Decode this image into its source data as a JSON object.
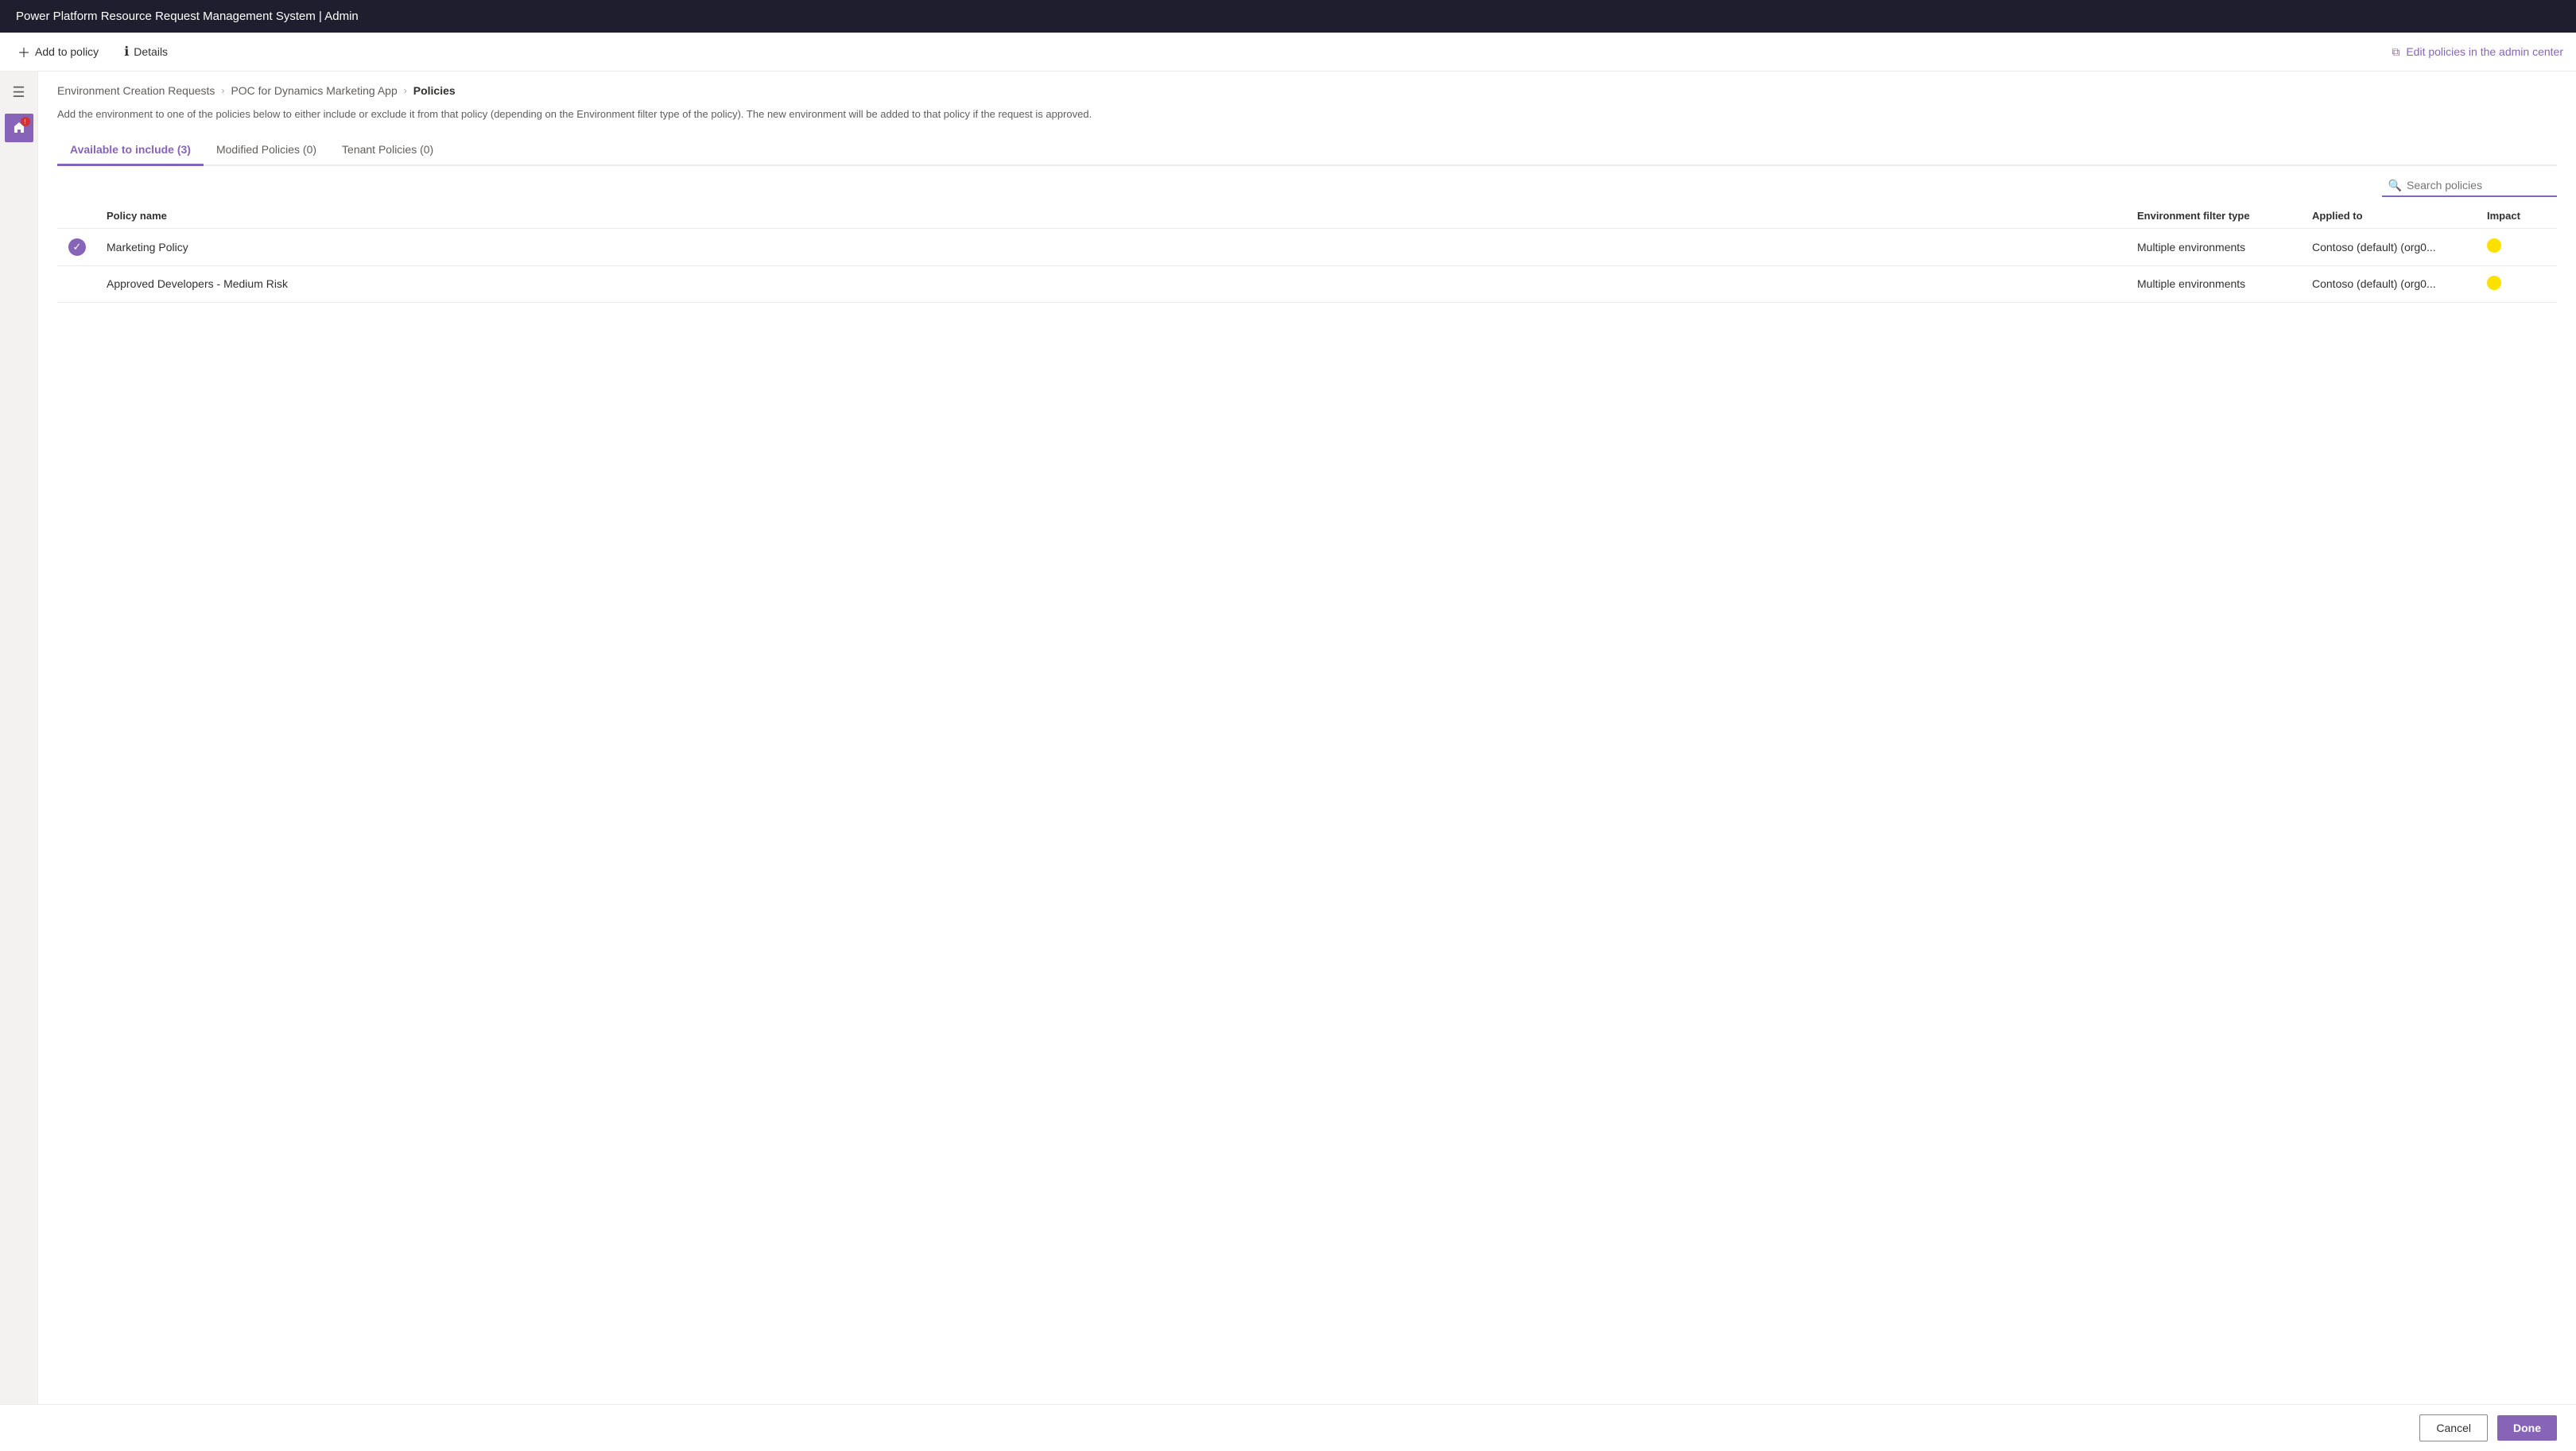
{
  "titleBar": {
    "text": "Power Platform Resource Request Management System | Admin"
  },
  "toolbar": {
    "addToPolicyLabel": "Add to policy",
    "detailsLabel": "Details",
    "editPoliciesLabel": "Edit policies in the admin center"
  },
  "breadcrumb": {
    "item1": "Environment Creation Requests",
    "item2": "POC for Dynamics Marketing App",
    "item3": "Policies"
  },
  "description": "Add the environment to one of the policies below to either include or exclude it from that policy (depending on the Environment filter type of the policy). The new environment will be added to that policy if the request is approved.",
  "tabs": [
    {
      "label": "Available to include (3)",
      "active": true
    },
    {
      "label": "Modified Policies (0)",
      "active": false
    },
    {
      "label": "Tenant Policies (0)",
      "active": false
    }
  ],
  "search": {
    "placeholder": "Search policies"
  },
  "table": {
    "columns": [
      {
        "key": "check",
        "label": ""
      },
      {
        "key": "policyName",
        "label": "Policy name"
      },
      {
        "key": "envFilterType",
        "label": "Environment filter type"
      },
      {
        "key": "appliedTo",
        "label": "Applied to"
      },
      {
        "key": "impact",
        "label": "Impact"
      }
    ],
    "rows": [
      {
        "selected": true,
        "policyName": "Marketing Policy",
        "envFilterType": "Multiple environments",
        "appliedTo": "Contoso (default) (org0...",
        "impact": "medium"
      },
      {
        "selected": false,
        "policyName": "Approved Developers - Medium Risk",
        "envFilterType": "Multiple environments",
        "appliedTo": "Contoso (default) (org0...",
        "impact": "medium"
      }
    ]
  },
  "footer": {
    "cancelLabel": "Cancel",
    "doneLabel": "Done"
  },
  "colors": {
    "accent": "#8764b8",
    "impactMedium": "#fce100",
    "titleBarBg": "#1e1e2e"
  }
}
